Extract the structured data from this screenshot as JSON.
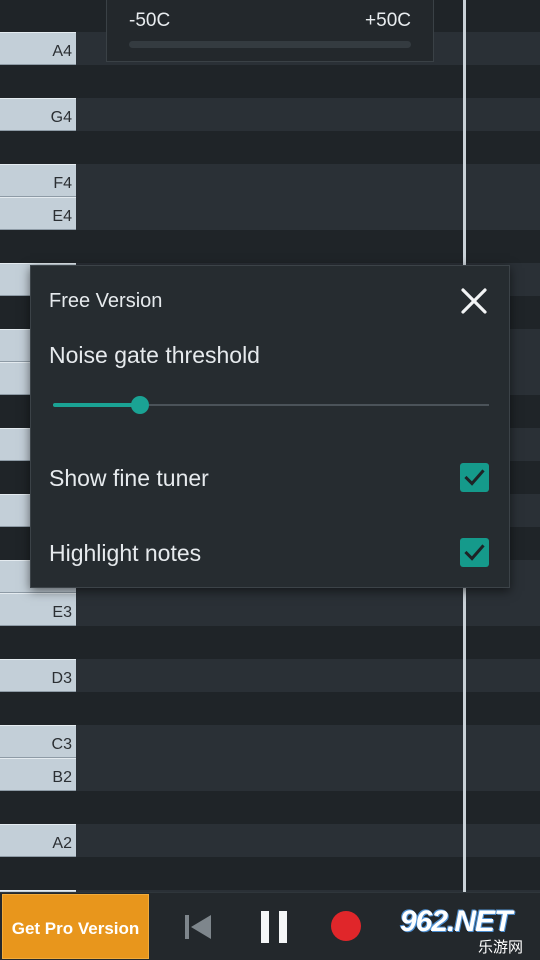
{
  "piano_roll": {
    "key_labels": {
      "a4": "A4",
      "g4": "G4",
      "f4": "F4",
      "e4": "E4",
      "e3": "E3",
      "d3": "D3",
      "c3": "C3",
      "b2": "B2",
      "a2": "A2"
    }
  },
  "fine_tuner": {
    "min_label": "-50C",
    "max_label": "+50C"
  },
  "settings_dialog": {
    "title": "Free Version",
    "noise_gate_label": "Noise gate threshold",
    "noise_gate_value": 0.2,
    "show_fine_tuner_label": "Show fine tuner",
    "show_fine_tuner_checked": true,
    "highlight_notes_label": "Highlight notes",
    "highlight_notes_checked": true
  },
  "bottom_bar": {
    "get_pro_label": "Get Pro Version",
    "icons": [
      "skip-back-icon",
      "pause-icon",
      "record-icon"
    ]
  },
  "watermark": {
    "main": "962.NET",
    "sub": "乐游网"
  },
  "colors": {
    "accent": "#1aa394",
    "pro_button": "#e8961c",
    "record": "#e0262a",
    "background": "#1c2125"
  }
}
